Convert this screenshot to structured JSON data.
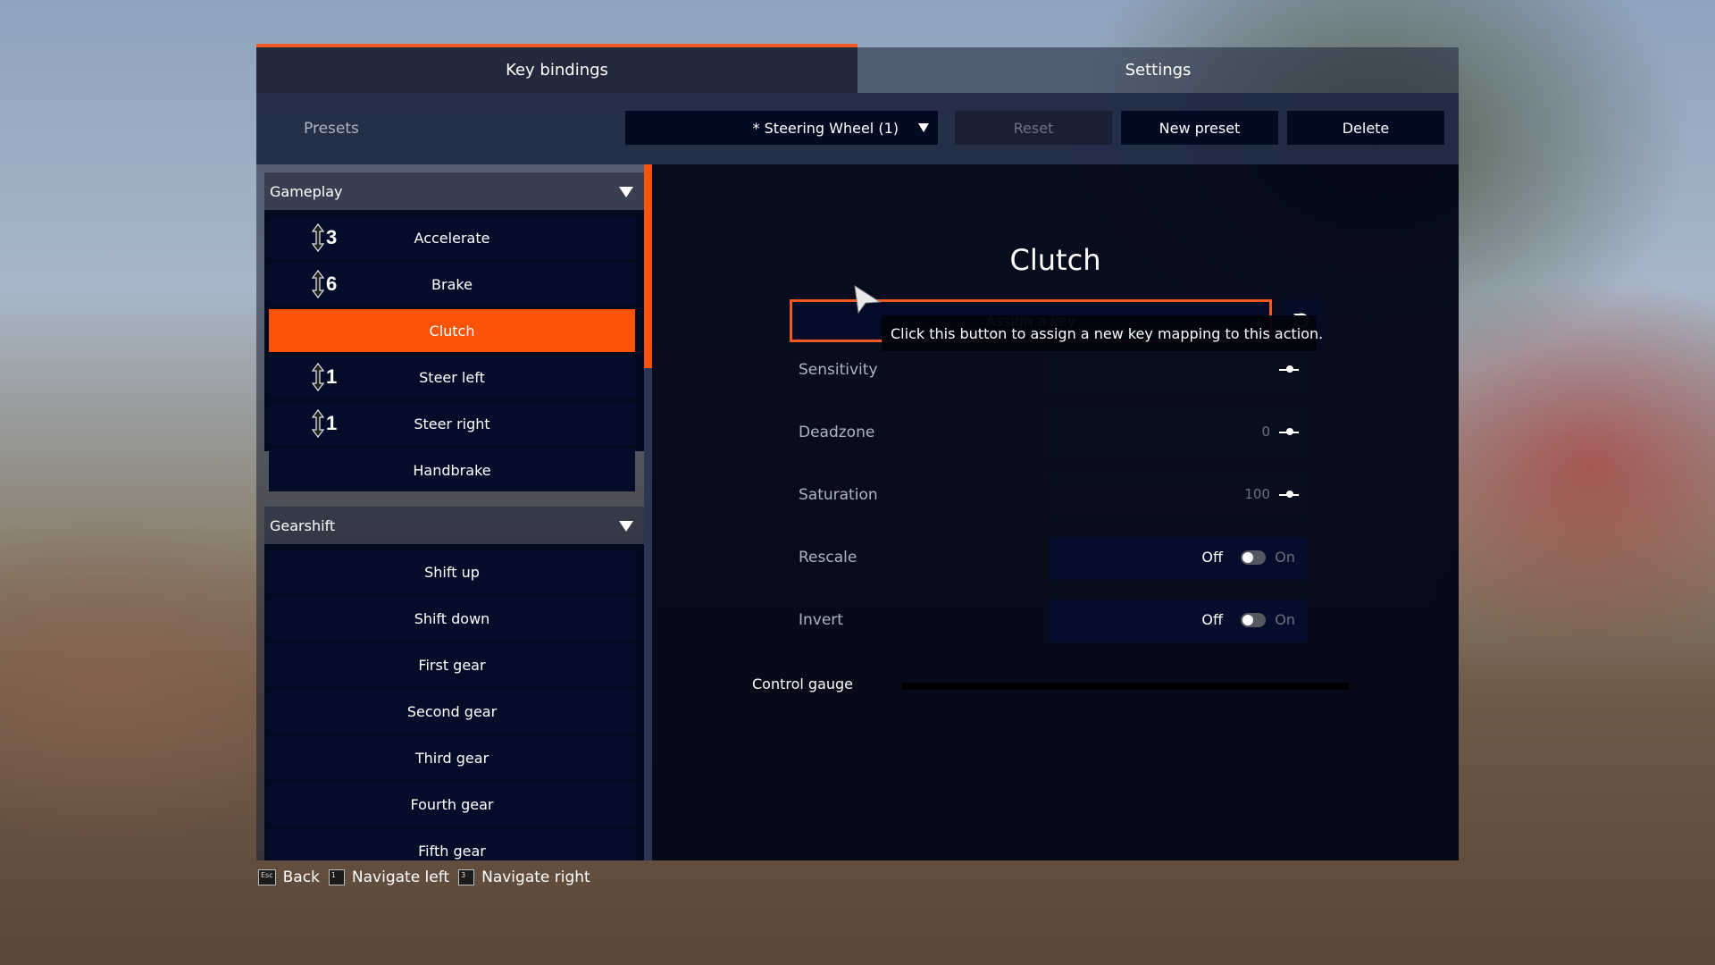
{
  "tabs": [
    {
      "label": "Key bindings",
      "active": true
    },
    {
      "label": "Settings",
      "active": false
    }
  ],
  "presets": {
    "label": "Presets",
    "selected": "* Steering Wheel (1)",
    "reset_label": "Reset",
    "new_label": "New preset",
    "delete_label": "Delete"
  },
  "sections": [
    {
      "title": "Gameplay",
      "items": [
        {
          "label": "Accelerate",
          "axis": "3",
          "selected": false
        },
        {
          "label": "Brake",
          "axis": "6",
          "selected": false
        },
        {
          "label": "Clutch",
          "axis": "",
          "selected": true
        },
        {
          "label": "Steer left",
          "axis": "1",
          "selected": false
        },
        {
          "label": "Steer right",
          "axis": "1",
          "selected": false
        },
        {
          "label": "Handbrake",
          "axis": "",
          "selected": false
        }
      ]
    },
    {
      "title": "Gearshift",
      "items": [
        {
          "label": "Shift up"
        },
        {
          "label": "Shift down"
        },
        {
          "label": "First gear"
        },
        {
          "label": "Second gear"
        },
        {
          "label": "Third gear"
        },
        {
          "label": "Fourth gear"
        },
        {
          "label": "Fifth gear"
        }
      ]
    }
  ],
  "detail": {
    "title": "Clutch",
    "assign_label": "Assign a key",
    "tooltip": "Click this button to assign a new key mapping to this action.",
    "settings": {
      "sensitivity": {
        "label": "Sensitivity"
      },
      "deadzone": {
        "label": "Deadzone",
        "value": "0"
      },
      "saturation": {
        "label": "Saturation",
        "value": "100"
      },
      "rescale": {
        "label": "Rescale",
        "off": "Off",
        "on": "On",
        "state": "off"
      },
      "invert": {
        "label": "Invert",
        "off": "Off",
        "on": "On",
        "state": "off"
      }
    },
    "gauge": {
      "label": "Control gauge",
      "value_percent": 0
    }
  },
  "footer": [
    {
      "key": "Esc",
      "label": "Back"
    },
    {
      "key": "1",
      "label": "Navigate left"
    },
    {
      "key": "3",
      "label": "Navigate right"
    }
  ],
  "colors": {
    "accent": "#fd5308",
    "panel": "#030b22"
  }
}
